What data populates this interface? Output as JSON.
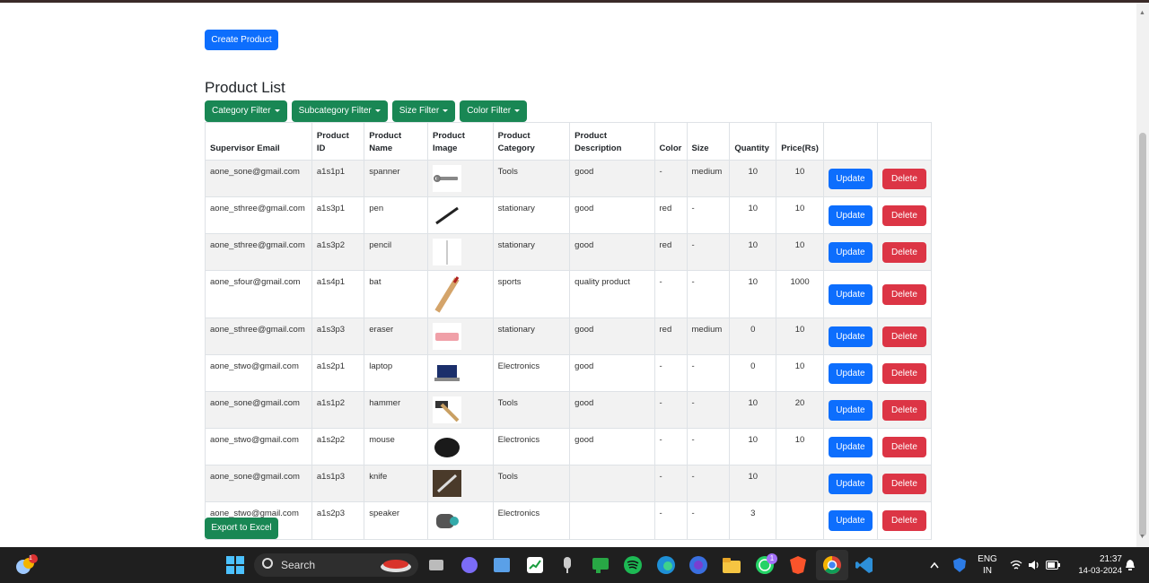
{
  "create_button": "Create Product",
  "title": "Product List",
  "filters": [
    "Category Filter",
    "Subcategory Filter",
    "Size Filter",
    "Color Filter"
  ],
  "table": {
    "headers": [
      "Supervisor Email",
      "Product ID",
      "Product Name",
      "Product Image",
      "Product Category",
      "Product Description",
      "Color",
      "Size",
      "Quantity",
      "Price(Rs)",
      "",
      ""
    ],
    "update_label": "Update",
    "delete_label": "Delete",
    "rows": [
      {
        "email": "aone_sone@gmail.com",
        "id": "a1s1p1",
        "name": "spanner",
        "image": "spanner-image",
        "category": "Tools",
        "description": "good",
        "color": "-",
        "size": "medium",
        "quantity": "10",
        "price": "10"
      },
      {
        "email": "aone_sthree@gmail.com",
        "id": "a1s3p1",
        "name": "pen",
        "image": "pen-image",
        "category": "stationary",
        "description": "good",
        "color": "red",
        "size": "-",
        "quantity": "10",
        "price": "10"
      },
      {
        "email": "aone_sthree@gmail.com",
        "id": "a1s3p2",
        "name": "pencil",
        "image": "pencil-image",
        "category": "stationary",
        "description": "good",
        "color": "red",
        "size": "-",
        "quantity": "10",
        "price": "10"
      },
      {
        "email": "aone_sfour@gmail.com",
        "id": "a1s4p1",
        "name": "bat",
        "image": "bat-image",
        "category": "sports",
        "description": "quality product",
        "color": "-",
        "size": "-",
        "quantity": "10",
        "price": "1000"
      },
      {
        "email": "aone_sthree@gmail.com",
        "id": "a1s3p3",
        "name": "eraser",
        "image": "eraser-image",
        "category": "stationary",
        "description": "good",
        "color": "red",
        "size": "medium",
        "quantity": "0",
        "price": "10"
      },
      {
        "email": "aone_stwo@gmail.com",
        "id": "a1s2p1",
        "name": "laptop",
        "image": "laptop-image",
        "category": "Electronics",
        "description": "good",
        "color": "-",
        "size": "-",
        "quantity": "0",
        "price": "10"
      },
      {
        "email": "aone_sone@gmail.com",
        "id": "a1s1p2",
        "name": "hammer",
        "image": "hammer-image",
        "category": "Tools",
        "description": "good",
        "color": "-",
        "size": "-",
        "quantity": "10",
        "price": "20"
      },
      {
        "email": "aone_stwo@gmail.com",
        "id": "a1s2p2",
        "name": "mouse",
        "image": "mouse-image",
        "category": "Electronics",
        "description": "good",
        "color": "-",
        "size": "-",
        "quantity": "10",
        "price": "10"
      },
      {
        "email": "aone_sone@gmail.com",
        "id": "a1s1p3",
        "name": "knife",
        "image": "knife-image",
        "category": "Tools",
        "description": "",
        "color": "-",
        "size": "-",
        "quantity": "10",
        "price": ""
      },
      {
        "email": "aone_stwo@gmail.com",
        "id": "a1s2p3",
        "name": "speaker",
        "image": "speaker-image",
        "category": "Electronics",
        "description": "",
        "color": "-",
        "size": "-",
        "quantity": "3",
        "price": ""
      }
    ]
  },
  "export_button": "Export to Excel",
  "taskbar": {
    "search_label": "Search",
    "language": "ENG",
    "region": "IN",
    "time": "21:37",
    "date": "14-03-2024",
    "whatsapp_badge": "1",
    "weather_badge": "1"
  },
  "colors": {
    "primary": "#0d6efd",
    "success": "#198754",
    "danger": "#dc3545"
  }
}
